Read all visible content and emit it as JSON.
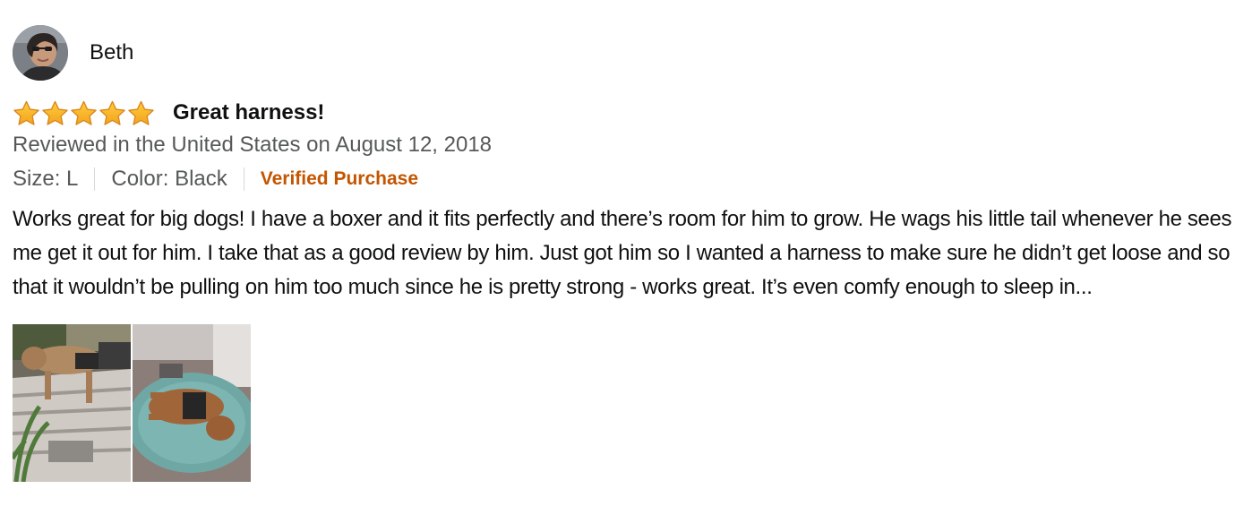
{
  "reviewer": {
    "name": "Beth",
    "avatar_icon": "profile-photo"
  },
  "rating": {
    "stars": 5,
    "max": 5,
    "star_color": "#f7a823"
  },
  "review": {
    "title": "Great harness!",
    "date_line": "Reviewed in the United States on August 12, 2018",
    "size": "Size: L",
    "color": "Color: Black",
    "verified": "Verified Purchase",
    "body": "Works great for big dogs! I have a boxer and it fits perfectly and there’s room for him to grow. He wags his little tail whenever he sees me get it out for him. I take that as a good review by him. Just got him so I wanted a harness to make sure he didn’t get loose and so that it wouldn’t be pulling on him too much since he is pretty strong - works great. It’s even comfy enough to sleep in..."
  },
  "images": [
    {
      "icon": "dog-on-stairs-photo"
    },
    {
      "icon": "dog-sleeping-photo"
    }
  ],
  "colors": {
    "verified": "#c45500",
    "secondary_text": "#565959",
    "primary_text": "#0f1111"
  }
}
